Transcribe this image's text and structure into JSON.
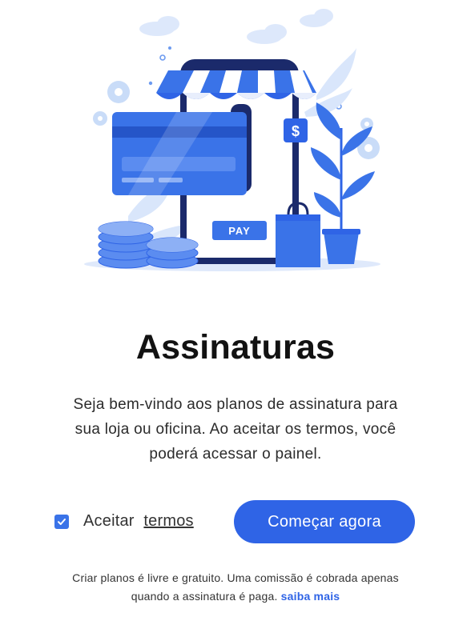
{
  "illustration": {
    "pay_label": "PAY",
    "dollar_symbol": "$"
  },
  "title": "Assinaturas",
  "description": {
    "line1": "Seja bem-vindo aos planos de assinatura para",
    "line2": "sua loja ou oficina. Ao aceitar os termos, você",
    "line3": "poderá acessar o painel."
  },
  "consent": {
    "label": "Aceitar",
    "link_label": "termos",
    "checked": true
  },
  "cta_label": "Começar agora",
  "footer": {
    "line1": "Criar planos é livre e gratuito. Uma comissão é cobrada apenas",
    "line2": "quando a assinatura é paga.",
    "link_label": "saiba mais"
  },
  "colors": {
    "primary": "#2f64e6",
    "checkbox": "#3a73e8",
    "illustration_dark": "#1b2a6b",
    "illustration_light": "#c7dcfa"
  }
}
